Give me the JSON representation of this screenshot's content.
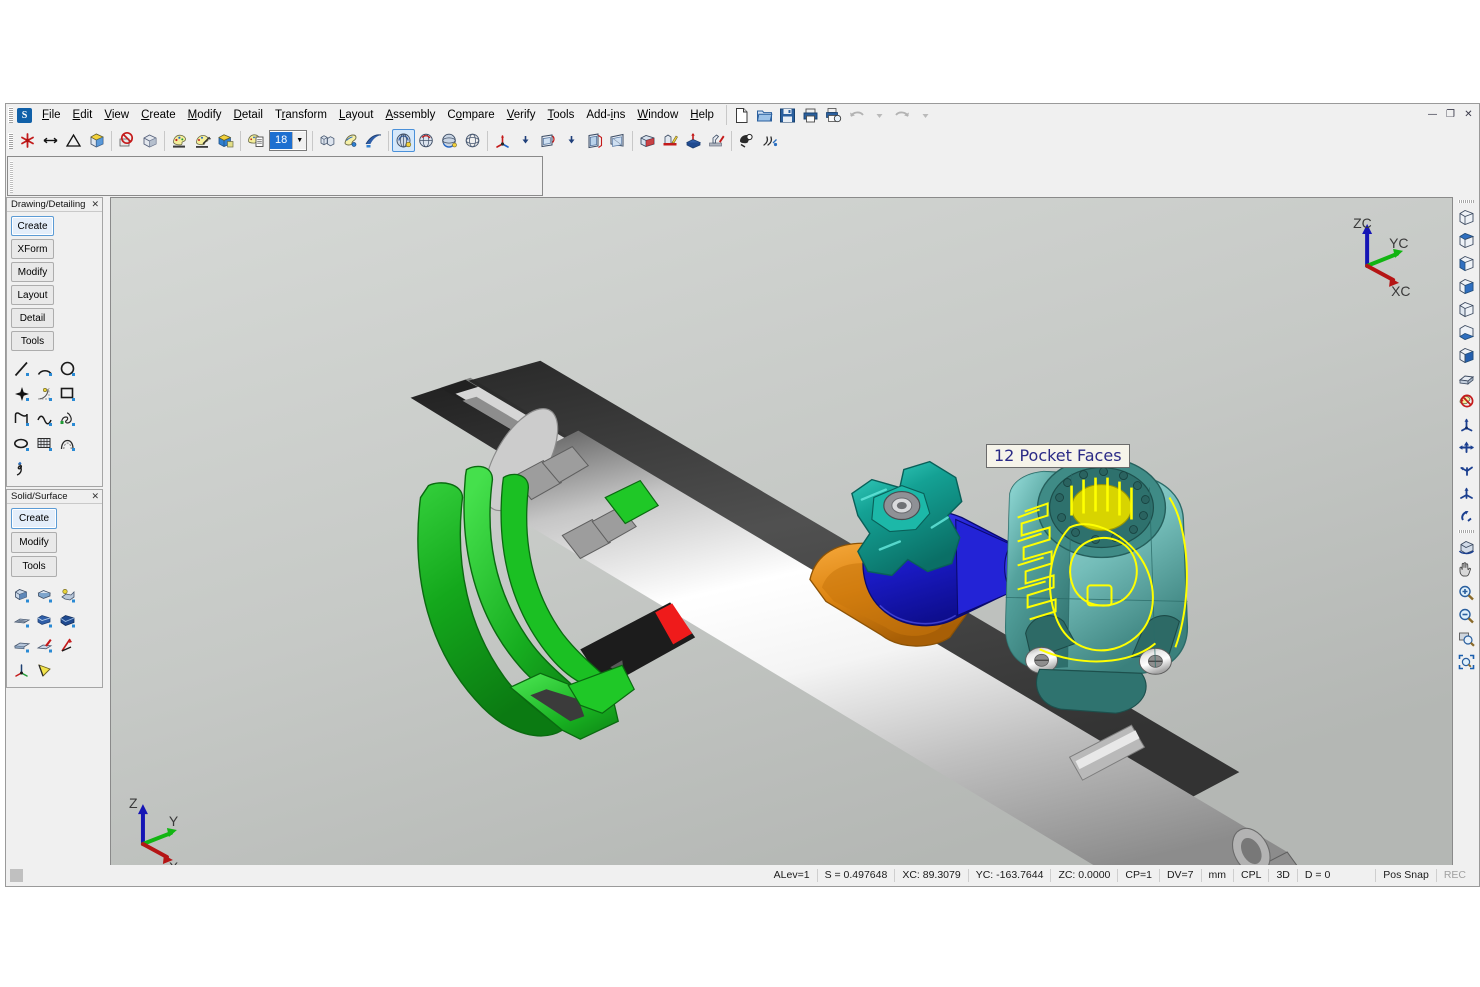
{
  "window": {
    "app_icon": "S",
    "controls": [
      {
        "name": "minimize-button",
        "glyph": "—"
      },
      {
        "name": "restore-button",
        "glyph": "❐"
      },
      {
        "name": "close-button",
        "glyph": "✕"
      }
    ]
  },
  "menubar": {
    "items": [
      {
        "label": "File",
        "accel": "F"
      },
      {
        "label": "Edit",
        "accel": "E"
      },
      {
        "label": "View",
        "accel": "V"
      },
      {
        "label": "Create",
        "accel": "C"
      },
      {
        "label": "Modify",
        "accel": "M"
      },
      {
        "label": "Detail",
        "accel": "D"
      },
      {
        "label": "Transform",
        "accel": "r"
      },
      {
        "label": "Layout",
        "accel": "L"
      },
      {
        "label": "Assembly",
        "accel": "A"
      },
      {
        "label": "Compare",
        "accel": "o"
      },
      {
        "label": "Verify",
        "accel": "V"
      },
      {
        "label": "Tools",
        "accel": "T"
      },
      {
        "label": "Add-ins",
        "accel": "i"
      },
      {
        "label": "Window",
        "accel": "W"
      },
      {
        "label": "Help",
        "accel": "H"
      }
    ]
  },
  "menubar_tools": [
    {
      "name": "new-file-icon",
      "title": "New"
    },
    {
      "name": "open-folder-icon",
      "title": "Open"
    },
    {
      "name": "save-icon",
      "title": "Save"
    },
    {
      "name": "print-icon",
      "title": "Print"
    },
    {
      "name": "print-preview-icon",
      "title": "Print Preview"
    },
    {
      "name": "undo-icon",
      "title": "Undo"
    },
    {
      "name": "undo-history-icon",
      "title": "Undo History"
    },
    {
      "name": "redo-icon",
      "title": "Redo"
    },
    {
      "name": "redo-history-icon",
      "title": "Redo History"
    }
  ],
  "toolbar": {
    "layer_value": "18",
    "groups": [
      {
        "name": "group-entity",
        "buttons": [
          {
            "name": "point-star-icon",
            "title": "Point"
          },
          {
            "name": "line-arrow-icon",
            "title": "Line"
          },
          {
            "name": "triangle-icon",
            "title": "Surface"
          },
          {
            "name": "solid-cube-icon",
            "title": "Solid"
          }
        ]
      },
      {
        "name": "group-blank",
        "buttons": [
          {
            "name": "blank-entity-icon",
            "title": "Blank"
          },
          {
            "name": "unblank-entity-icon",
            "title": "Unblank"
          }
        ]
      },
      {
        "name": "group-color",
        "buttons": [
          {
            "name": "color-palette-icon",
            "title": "Color"
          },
          {
            "name": "attributes-icon",
            "title": "Attributes"
          },
          {
            "name": "level-cube-icon",
            "title": "Level"
          }
        ]
      },
      {
        "name": "group-level",
        "buttons": [
          {
            "name": "level-manager-icon",
            "title": "Level Manager"
          }
        ]
      },
      {
        "name": "group-shade",
        "buttons": [
          {
            "name": "wireframe-shade-icon",
            "title": "Wireframe"
          },
          {
            "name": "hidden-line-icon",
            "title": "Hidden Line"
          },
          {
            "name": "shaded-swoosh-icon",
            "title": "Shaded"
          }
        ]
      },
      {
        "name": "group-dynamic-view",
        "buttons": [
          {
            "name": "dynamic-rotate-icon",
            "title": "Dynamic Rotate",
            "selected": true
          },
          {
            "name": "rotate-view-icon",
            "title": "Rotate View"
          },
          {
            "name": "spin-view-icon",
            "title": "Spin"
          },
          {
            "name": "orbit-view-icon",
            "title": "Orbit"
          }
        ]
      },
      {
        "name": "group-cpl",
        "buttons": [
          {
            "name": "cpl-axes-icon",
            "title": "Construction Plane"
          },
          {
            "name": "cpl-dropdown-icon",
            "title": "CPL options"
          },
          {
            "name": "view-plane-icon",
            "title": "View Plane"
          },
          {
            "name": "view-dropdown-icon",
            "title": "View options"
          },
          {
            "name": "screen-view-icon",
            "title": "Screen View"
          },
          {
            "name": "named-view-icon",
            "title": "Named View"
          }
        ]
      },
      {
        "name": "group-toolpath",
        "buttons": [
          {
            "name": "toolpath-box-icon",
            "title": "Toolpath"
          },
          {
            "name": "stock-setup-icon",
            "title": "Stock Setup"
          },
          {
            "name": "machine-group-icon",
            "title": "Machine Group"
          },
          {
            "name": "verify-toolpath-icon",
            "title": "Verify"
          }
        ]
      },
      {
        "name": "group-analyze",
        "buttons": [
          {
            "name": "analyze-entity-icon",
            "title": "Analyze"
          },
          {
            "name": "measure-icon",
            "title": "Measure"
          }
        ]
      }
    ]
  },
  "panels": [
    {
      "name": "drawing-detailing",
      "title": "Drawing/Detailing",
      "close_glyph": "✕",
      "buttons": [
        {
          "label": "Create",
          "active": true
        },
        {
          "label": "XForm",
          "active": false
        },
        {
          "label": "Modify",
          "active": false
        },
        {
          "label": "Layout",
          "active": false
        },
        {
          "label": "Detail",
          "active": false
        },
        {
          "label": "Tools",
          "active": false
        }
      ],
      "icons": [
        {
          "name": "line-icon"
        },
        {
          "name": "arc-icon"
        },
        {
          "name": "circle-icon"
        },
        {
          "name": "point-icon"
        },
        {
          "name": "fillet-icon"
        },
        {
          "name": "rectangle-icon"
        },
        {
          "name": "polyline-icon"
        },
        {
          "name": "spline-icon"
        },
        {
          "name": "freeform-curve-icon"
        },
        {
          "name": "ellipse-icon"
        },
        {
          "name": "grid-pattern-icon"
        },
        {
          "name": "offset-curve-icon"
        },
        {
          "name": "sketch-icon"
        }
      ]
    },
    {
      "name": "solid-surface",
      "title": "Solid/Surface",
      "close_glyph": "✕",
      "buttons": [
        {
          "label": "Create",
          "active": true
        },
        {
          "label": "Modify",
          "active": false
        },
        {
          "label": "Tools",
          "active": false
        }
      ],
      "icons": [
        {
          "name": "extrude-solid-icon"
        },
        {
          "name": "revolve-solid-icon"
        },
        {
          "name": "sweep-solid-icon"
        },
        {
          "name": "loft-solid-icon"
        },
        {
          "name": "boolean-add-icon"
        },
        {
          "name": "boolean-subtract-icon"
        },
        {
          "name": "shell-solid-icon"
        },
        {
          "name": "draft-solid-icon"
        },
        {
          "name": "ruled-surface-icon"
        },
        {
          "name": "net-surface-icon"
        },
        {
          "name": "trim-surface-icon"
        }
      ]
    }
  ],
  "right_toolbar": {
    "groups": [
      {
        "name": "view-group",
        "buttons": [
          {
            "name": "isometric-view-icon"
          },
          {
            "name": "top-view-icon"
          },
          {
            "name": "front-view-icon"
          },
          {
            "name": "right-view-icon"
          },
          {
            "name": "back-view-icon"
          },
          {
            "name": "bottom-view-icon"
          },
          {
            "name": "left-view-icon"
          },
          {
            "name": "section-view-icon"
          },
          {
            "name": "clear-colors-icon"
          },
          {
            "name": "gnomon-rotate-icon"
          },
          {
            "name": "axis-triad-icon"
          },
          {
            "name": "translate-icon"
          },
          {
            "name": "move-entity-icon"
          },
          {
            "name": "rotate-entity-icon"
          },
          {
            "name": "mirror-entity-icon"
          }
        ]
      },
      {
        "name": "zoom-group",
        "buttons": [
          {
            "name": "dynamic-rotate-view-icon"
          },
          {
            "name": "pan-hand-icon"
          },
          {
            "name": "zoom-in-icon"
          },
          {
            "name": "zoom-out-icon"
          },
          {
            "name": "zoom-window-icon"
          },
          {
            "name": "fit-to-screen-icon"
          }
        ]
      }
    ]
  },
  "viewport": {
    "annotation": {
      "name": "pocket-faces-label",
      "text": "12 Pocket Faces"
    },
    "axis_triad_top_right": {
      "z": "ZC",
      "y": "YC",
      "x": "XC"
    },
    "axis_triad_bottom_left": {
      "z": "Z",
      "y": "Y",
      "x": "X"
    },
    "colors": {
      "background_top": "#d3d6d3",
      "background_bottom": "#b9bcb9",
      "clamp_green": "#1fac29",
      "knob_teal": "#1d9e93",
      "elbow_blue": "#1f1fc8",
      "bracket_orange": "#e08a17",
      "housing_teal": "#3d8f8a",
      "highlight_yellow": "#f5f500",
      "indicator_red": "#ef1b1b",
      "body_steel": "#f2f2f2",
      "body_dark": "#3a3a3a"
    }
  },
  "statusbar": {
    "cells": [
      {
        "name": "alev-cell",
        "text": "ALev=1",
        "dim": false
      },
      {
        "name": "scale-cell",
        "text": "S = 0.497648",
        "dim": false
      },
      {
        "name": "xc-cell",
        "text": "XC: 89.3079",
        "dim": false
      },
      {
        "name": "yc-cell",
        "text": "YC: -163.7644",
        "dim": false
      },
      {
        "name": "zc-cell",
        "text": "ZC: 0.0000",
        "dim": false
      },
      {
        "name": "cp-cell",
        "text": "CP=1",
        "dim": false
      },
      {
        "name": "dv-cell",
        "text": "DV=7",
        "dim": false
      },
      {
        "name": "units-cell",
        "text": "mm",
        "dim": false
      },
      {
        "name": "cpl-cell",
        "text": "CPL",
        "dim": false
      },
      {
        "name": "mode-cell",
        "text": "3D",
        "dim": false
      },
      {
        "name": "depth-cell",
        "text": "D = 0",
        "dim": false
      },
      {
        "name": "pos-snap-cell",
        "text": "Pos Snap",
        "dim": false
      },
      {
        "name": "rec-cell",
        "text": "REC",
        "dim": true
      }
    ]
  }
}
